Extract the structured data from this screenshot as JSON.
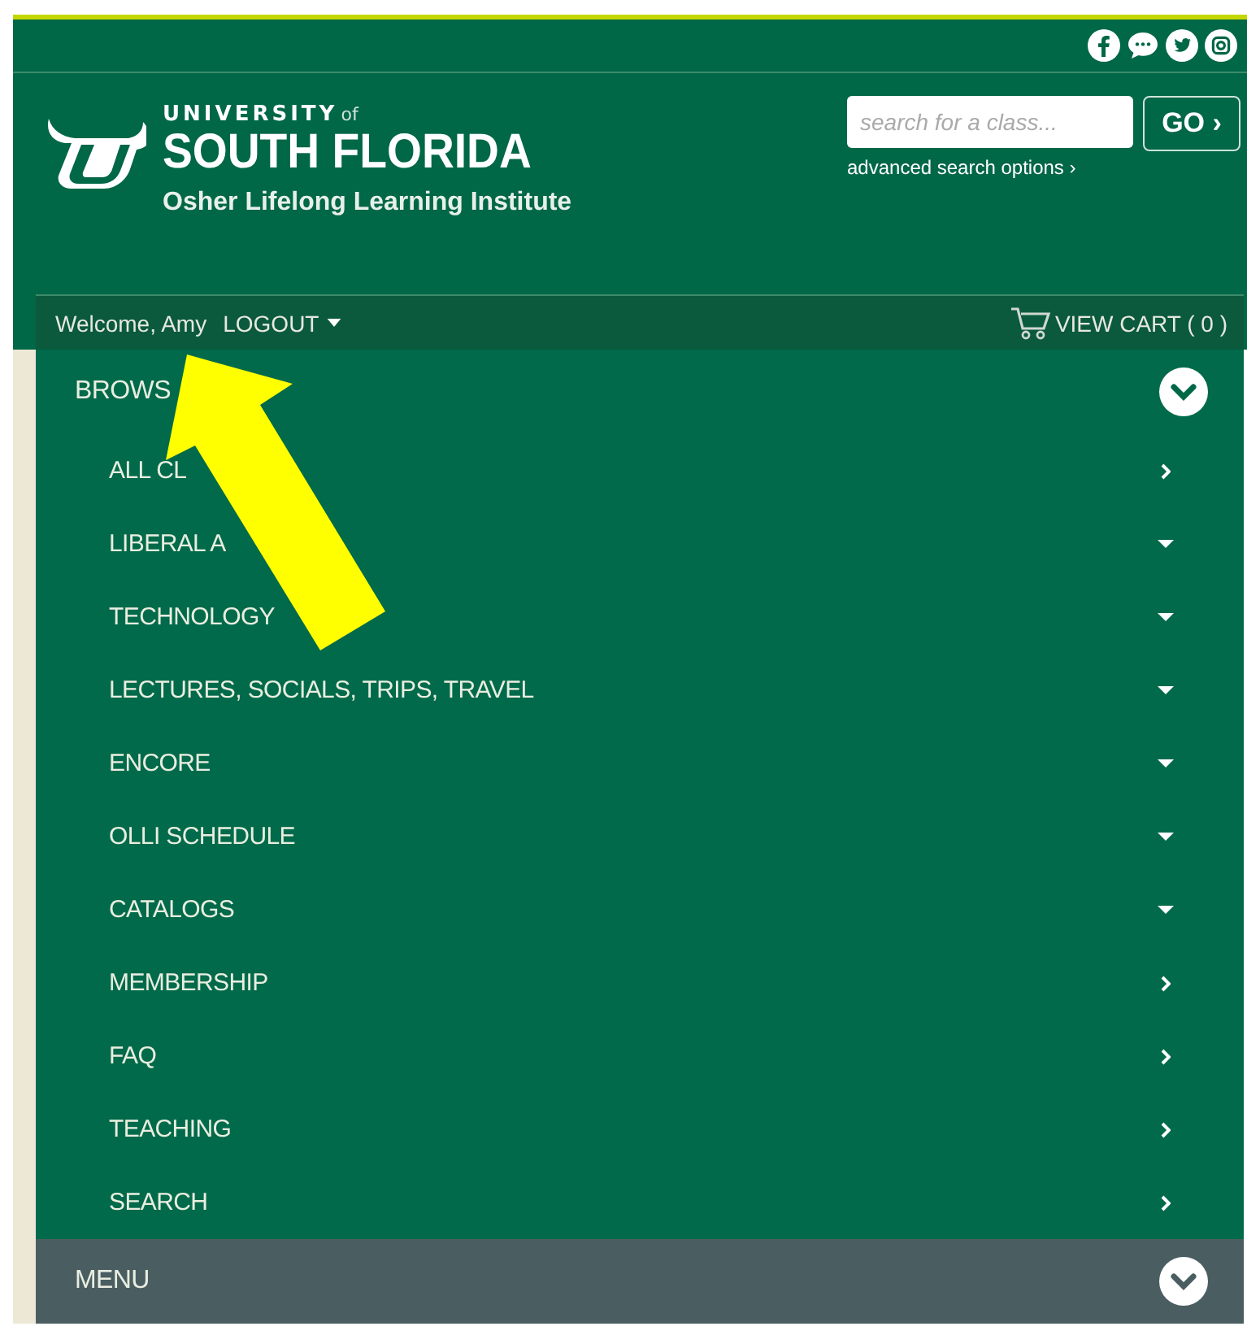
{
  "header": {
    "university_small": "UNIVERSITY",
    "university_of": "of",
    "university_name": "SOUTH FLORIDA",
    "institute": "Osher Lifelong Learning Institute"
  },
  "search": {
    "placeholder": "search for a class...",
    "button": "GO ›",
    "advanced": "advanced search options ›"
  },
  "user_bar": {
    "welcome": "Welcome, Amy",
    "logout": "LOGOUT",
    "cart": "VIEW CART ( 0 )"
  },
  "browse": {
    "title": "BROWS",
    "expanded": true,
    "items": [
      {
        "label": "ALL CL",
        "kind": "link"
      },
      {
        "label": "LIBERAL A",
        "kind": "dropdown"
      },
      {
        "label": "TECHNOLOGY",
        "kind": "dropdown"
      },
      {
        "label": "LECTURES, SOCIALS, TRIPS, TRAVEL",
        "kind": "dropdown"
      },
      {
        "label": "ENCORE",
        "kind": "dropdown"
      },
      {
        "label": "OLLI SCHEDULE",
        "kind": "dropdown"
      },
      {
        "label": "CATALOGS",
        "kind": "dropdown"
      },
      {
        "label": "MEMBERSHIP",
        "kind": "link"
      },
      {
        "label": "FAQ",
        "kind": "link"
      },
      {
        "label": "TEACHING",
        "kind": "link"
      },
      {
        "label": "SEARCH",
        "kind": "link"
      }
    ]
  },
  "menu": {
    "title": "MENU",
    "expanded": false
  }
}
